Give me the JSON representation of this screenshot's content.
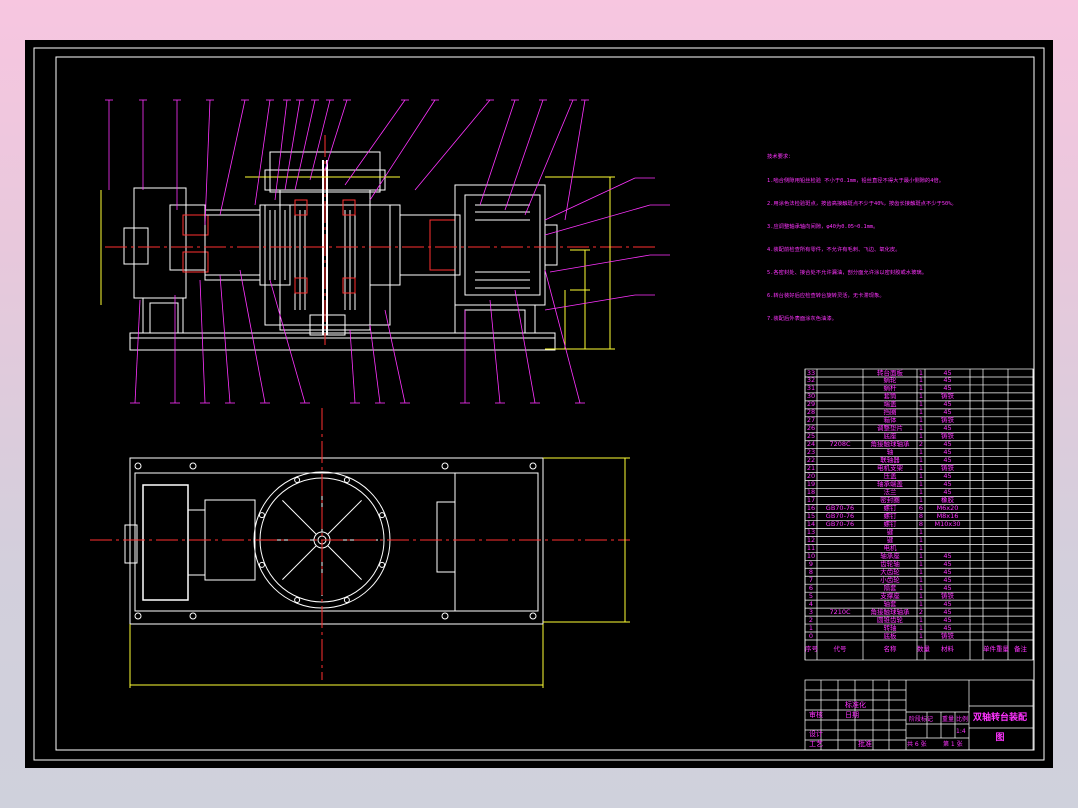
{
  "drawing": {
    "title": "双轴转台装配图",
    "scale": "1:4",
    "sheet_total_label": "共 6 张",
    "sheet_label": "第 1 张"
  },
  "technical_notes": [
    "技术要求：",
    "1.啮合侧隙用铅丝检验 不小于0.1mm，铅丝直径不得大于最小侧隙的4倍。",
    "2.用涂色法检验斑点，按齿高接触斑点不少于40%，按齿长接触斑点不少于50%。",
    "3.应调整轴承轴向间隙，φ40为0.05~0.1mm。",
    "4.装配前检查所有零件，不允许有毛刺、飞边、氧化皮。",
    "5.各密封处、接合处不允许漏油，剖分面允许涂以密封胶或水玻璃。",
    "6.转台装好后应检查转台旋转灵活，无卡滞现象。",
    "7.装配后外表面涂灰色油漆。"
  ],
  "bom_rows": [
    {
      "no": "33",
      "code": "",
      "name": "转台面板",
      "qty": "1",
      "mat": "45"
    },
    {
      "no": "32",
      "code": "",
      "name": "蜗轮",
      "qty": "1",
      "mat": "45"
    },
    {
      "no": "31",
      "code": "",
      "name": "蜗杆",
      "qty": "1",
      "mat": "45"
    },
    {
      "no": "30",
      "code": "",
      "name": "套筒",
      "qty": "1",
      "mat": "铸铁"
    },
    {
      "no": "29",
      "code": "",
      "name": "端盖",
      "qty": "1",
      "mat": "45"
    },
    {
      "no": "28",
      "code": "",
      "name": "挡圈",
      "qty": "1",
      "mat": "45"
    },
    {
      "no": "27",
      "code": "",
      "name": "箱体",
      "qty": "1",
      "mat": "铸铁"
    },
    {
      "no": "26",
      "code": "",
      "name": "调整垫片",
      "qty": "1",
      "mat": "45"
    },
    {
      "no": "25",
      "code": "",
      "name": "底座",
      "qty": "1",
      "mat": "铸铁"
    },
    {
      "no": "24",
      "code": "7208C",
      "name": "角接触球轴承",
      "qty": "2",
      "mat": "45"
    },
    {
      "no": "23",
      "code": "",
      "name": "轴",
      "qty": "1",
      "mat": "45"
    },
    {
      "no": "22",
      "code": "",
      "name": "联轴器",
      "qty": "1",
      "mat": "45"
    },
    {
      "no": "21",
      "code": "",
      "name": "电机支架",
      "qty": "1",
      "mat": "铸铁"
    },
    {
      "no": "20",
      "code": "",
      "name": "压盖",
      "qty": "1",
      "mat": "45"
    },
    {
      "no": "19",
      "code": "",
      "name": "轴承端盖",
      "qty": "1",
      "mat": "45"
    },
    {
      "no": "18",
      "code": "",
      "name": "法兰",
      "qty": "1",
      "mat": "45"
    },
    {
      "no": "17",
      "code": "",
      "name": "密封圈",
      "qty": "1",
      "mat": "橡胶"
    },
    {
      "no": "16",
      "code": "GB70-76",
      "name": "螺钉",
      "qty": "6",
      "mat": "M6x20"
    },
    {
      "no": "15",
      "code": "GB70-76",
      "name": "螺钉",
      "qty": "8",
      "mat": "M8x16"
    },
    {
      "no": "14",
      "code": "GB70-76",
      "name": "螺钉",
      "qty": "8",
      "mat": "M10x30"
    },
    {
      "no": "13",
      "code": "",
      "name": "键",
      "qty": "1",
      "mat": ""
    },
    {
      "no": "12",
      "code": "",
      "name": "键",
      "qty": "1",
      "mat": ""
    },
    {
      "no": "11",
      "code": "",
      "name": "电机",
      "qty": "1",
      "mat": ""
    },
    {
      "no": "10",
      "code": "",
      "name": "轴承座",
      "qty": "1",
      "mat": "45"
    },
    {
      "no": "9",
      "code": "",
      "name": "齿轮轴",
      "qty": "1",
      "mat": "45"
    },
    {
      "no": "8",
      "code": "",
      "name": "大齿轮",
      "qty": "1",
      "mat": "45"
    },
    {
      "no": "7",
      "code": "",
      "name": "小齿轮",
      "qty": "1",
      "mat": "45"
    },
    {
      "no": "6",
      "code": "",
      "name": "隔套",
      "qty": "1",
      "mat": "45"
    },
    {
      "no": "5",
      "code": "",
      "name": "支撑座",
      "qty": "1",
      "mat": "铸铁"
    },
    {
      "no": "4",
      "code": "",
      "name": "轴套",
      "qty": "1",
      "mat": "45"
    },
    {
      "no": "3",
      "code": "7210C",
      "name": "角接触球轴承",
      "qty": "2",
      "mat": "45"
    },
    {
      "no": "2",
      "code": "",
      "name": "圆锥齿轮",
      "qty": "1",
      "mat": "45"
    },
    {
      "no": "1",
      "code": "",
      "name": "转轴",
      "qty": "1",
      "mat": "45"
    },
    {
      "no": "0",
      "code": "",
      "name": "底板",
      "qty": "1",
      "mat": "铸铁"
    }
  ],
  "bom_header": {
    "no": "序号",
    "code": "代号",
    "name": "名称",
    "qty": "数量",
    "mat": "材料",
    "unit_weight": "单件重量",
    "remark": "备注"
  },
  "title_block": {
    "designer": "设计",
    "checker": "审核",
    "approved": "批准",
    "process": "工艺",
    "stage_mark": "阶段标记",
    "weight": "重量",
    "ratio": "比例",
    "signature": "标准化",
    "date": "日期"
  },
  "colors": {
    "line_white": "#ffffff",
    "line_magenta": "#ff33ff",
    "line_yellow": "#ffff33",
    "line_red": "#ff2020",
    "background": "#000000"
  }
}
